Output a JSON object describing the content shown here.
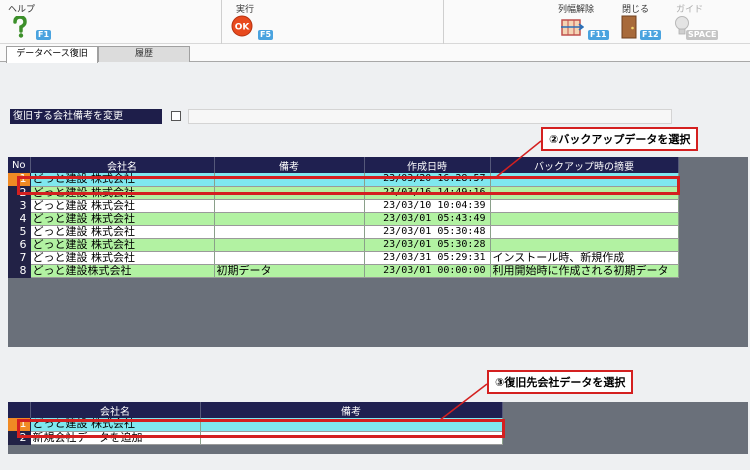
{
  "toolbar": {
    "help_label": "ヘルプ",
    "help_key": "F1",
    "exec_label": "実行",
    "exec_key": "F5",
    "release_label": "列幅解除",
    "release_key": "F11",
    "close_label": "閉じる",
    "close_key": "F12",
    "guide_label": "ガイド",
    "guide_key": "SPACE"
  },
  "tabs": [
    {
      "label": "データベース復旧"
    },
    {
      "label": "履歴"
    }
  ],
  "memo": {
    "label": "復旧する会社備考を変更",
    "input_value": ""
  },
  "backup_table": {
    "headers": [
      "No",
      "会社名",
      "備考",
      "作成日時",
      "バックアップ時の摘要"
    ],
    "rows": [
      {
        "no": "1",
        "company": "どっと建設 株式会社",
        "memo": "",
        "date": "23/03/20 16:28:57",
        "summary": ""
      },
      {
        "no": "2",
        "company": "どっと建設 株式会社",
        "memo": "",
        "date": "23/03/16 14:49:16",
        "summary": ""
      },
      {
        "no": "3",
        "company": "どっと建設 株式会社",
        "memo": "",
        "date": "23/03/10 10:04:39",
        "summary": ""
      },
      {
        "no": "4",
        "company": "どっと建設 株式会社",
        "memo": "",
        "date": "23/03/01 05:43:49",
        "summary": ""
      },
      {
        "no": "5",
        "company": "どっと建設 株式会社",
        "memo": "",
        "date": "23/03/01 05:30:48",
        "summary": ""
      },
      {
        "no": "6",
        "company": "どっと建設 株式会社",
        "memo": "",
        "date": "23/03/01 05:30:28",
        "summary": ""
      },
      {
        "no": "7",
        "company": "どっと建設 株式会社",
        "memo": "",
        "date": "23/03/31 05:29:31",
        "summary": "インストール時、新規作成"
      },
      {
        "no": "8",
        "company": "どっと建設株式会社",
        "memo": "初期データ",
        "date": "23/03/01 00:00:00",
        "summary": "利用開始時に作成される初期データ"
      }
    ]
  },
  "target_table": {
    "headers": [
      "",
      "会社名",
      "備考"
    ],
    "rows": [
      {
        "no": "1",
        "company": "どっと建設 株式会社",
        "memo": ""
      },
      {
        "no": "2",
        "company": "新規会社データを追加",
        "memo": ""
      }
    ]
  },
  "annotations": {
    "backup_callout": "②バックアップデータを選択",
    "target_callout": "③復旧先会社データを選択"
  },
  "colors": {
    "header_navy": "#1f2050",
    "row_green": "#b2f2a2",
    "row_selected_cyan": "#7fe8ef",
    "selected_number_orange": "#f08a24",
    "annotation_red": "#d42020"
  }
}
